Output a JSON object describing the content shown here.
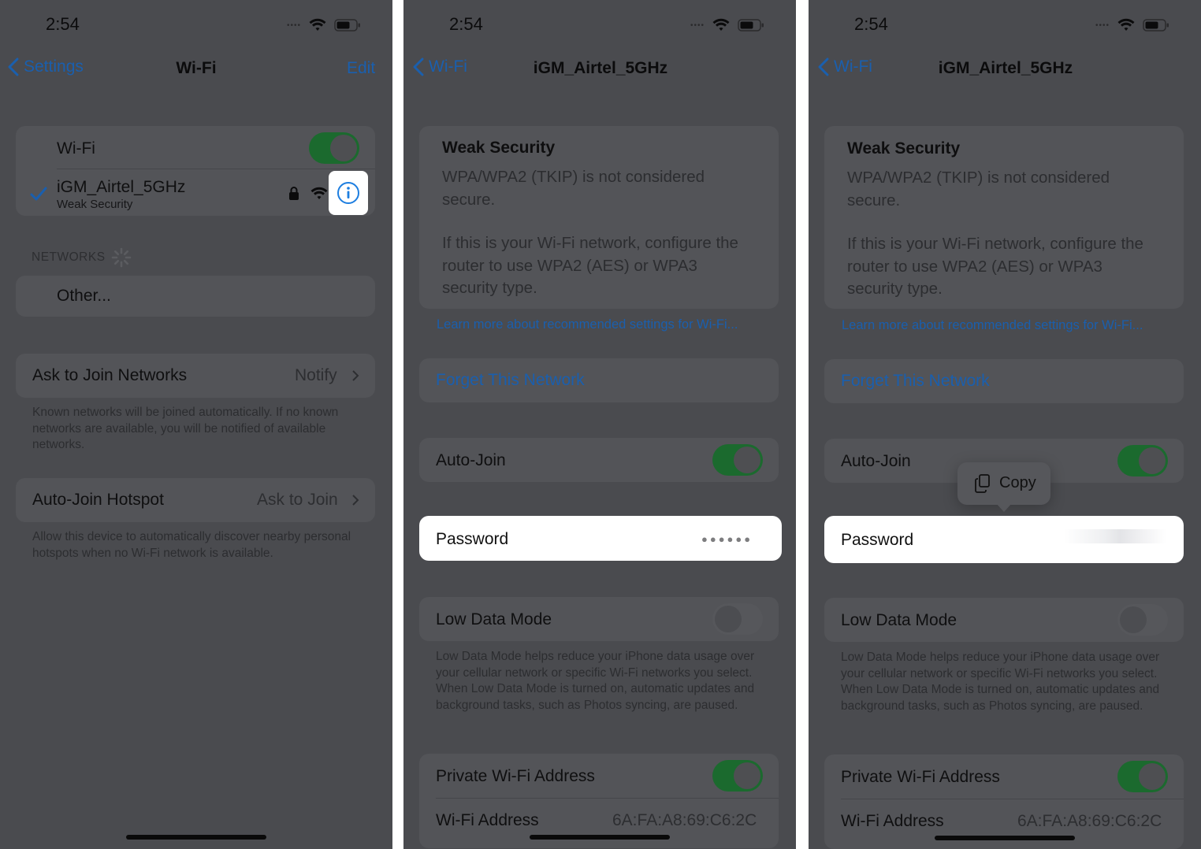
{
  "status": {
    "time": "2:54"
  },
  "screen1": {
    "back_label": "Settings",
    "title": "Wi-Fi",
    "edit_label": "Edit",
    "wifi_label": "Wi-Fi",
    "wifi_toggle": "on",
    "network_name": "iGM_Airtel_5GHz",
    "network_sub": "Weak Security",
    "networks_header": "NETWORKS",
    "other_label": "Other...",
    "ask_join_label": "Ask to Join Networks",
    "ask_join_value": "Notify",
    "ask_join_footer": "Known networks will be joined automatically. If no known networks are available, you will be notified of available networks.",
    "hotspot_label": "Auto-Join Hotspot",
    "hotspot_value": "Ask to Join",
    "hotspot_footer": "Allow this device to automatically discover nearby personal hotspots when no Wi-Fi network is available."
  },
  "screen2": {
    "back_label": "Wi-Fi",
    "title": "iGM_Airtel_5GHz",
    "weak_title": "Weak Security",
    "weak_text_1": "WPA/WPA2 (TKIP) is not considered secure.",
    "weak_text_2": "If this is your Wi-Fi network, configure the router to use WPA2 (AES) or WPA3 security type.",
    "learn_more": "Learn more about recommended settings for Wi-Fi...",
    "forget": "Forget This Network",
    "auto_join": "Auto-Join",
    "password_label": "Password",
    "password_dots": "●●●●●●",
    "low_data": "Low Data Mode",
    "low_data_footer": "Low Data Mode helps reduce your iPhone data usage over your cellular network or specific Wi-Fi networks you select. When Low Data Mode is turned on, automatic updates and background tasks, such as Photos syncing, are paused.",
    "private_address": "Private Wi-Fi Address",
    "wifi_address_label": "Wi-Fi Address",
    "wifi_address_value": "6A:FA:A8:69:C6:2C"
  },
  "screen3": {
    "back_label": "Wi-Fi",
    "title": "iGM_Airtel_5GHz",
    "weak_title": "Weak Security",
    "weak_text_1": "WPA/WPA2 (TKIP) is not considered secure.",
    "weak_text_2": "If this is your Wi-Fi network, configure the router to use WPA2 (AES) or WPA3 security type.",
    "learn_more": "Learn more about recommended settings for Wi-Fi...",
    "forget": "Forget This Network",
    "auto_join": "Auto-Join",
    "copy_label": "Copy",
    "password_label": "Password",
    "low_data": "Low Data Mode",
    "low_data_footer": "Low Data Mode helps reduce your iPhone data usage over your cellular network or specific Wi-Fi networks you select. When Low Data Mode is turned on, automatic updates and background tasks, such as Photos syncing, are paused.",
    "private_address": "Private Wi-Fi Address",
    "wifi_address_label": "Wi-Fi Address",
    "wifi_address_value": "6A:FA:A8:69:C6:2C"
  },
  "colors": {
    "dim_background": "#4a4b4f",
    "accent_blue": "#1a5fae",
    "toggle_on": "#1b6a2e",
    "highlight": "#ffffff"
  },
  "icons": [
    "back-chevron-icon",
    "wifi-icon",
    "battery-icon",
    "lock-icon",
    "info-icon",
    "checkmark-icon",
    "spinner-icon",
    "copy-icon",
    "chevron-right-icon"
  ]
}
